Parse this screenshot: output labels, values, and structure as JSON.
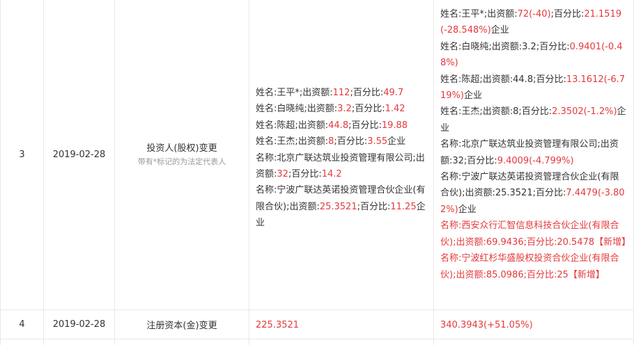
{
  "rows": [
    {
      "index": "3",
      "date": "2019-02-28",
      "item": "投资人(股权)变更",
      "note": "带有*标记的为法定代表人",
      "before": [
        [
          {
            "t": "姓名:王平*;出资额:"
          },
          {
            "t": "112",
            "r": true
          },
          {
            "t": ";百分比:"
          },
          {
            "t": "49.7",
            "r": true
          }
        ],
        [
          {
            "t": "姓名:白晓纯;出资额:"
          },
          {
            "t": "3.2",
            "r": true
          },
          {
            "t": ";百分比:"
          },
          {
            "t": "1.42",
            "r": true
          }
        ],
        [
          {
            "t": "姓名:陈超;出资额:"
          },
          {
            "t": "44.8",
            "r": true
          },
          {
            "t": ";百分比:"
          },
          {
            "t": "19.88",
            "r": true
          }
        ],
        [
          {
            "t": "姓名:王杰;出资额:"
          },
          {
            "t": "8",
            "r": true
          },
          {
            "t": ";百分比:"
          },
          {
            "t": "3.55",
            "r": true
          },
          {
            "t": "企业"
          }
        ],
        [
          {
            "t": "名称:北京广联达筑业投资管理有限公司;出资额:"
          },
          {
            "t": "32",
            "r": true
          },
          {
            "t": ";百分比:"
          },
          {
            "t": "14.2",
            "r": true
          }
        ],
        [
          {
            "t": "名称:宁波广联达英诺投资管理合伙企业(有限合伙);出资额:"
          },
          {
            "t": "25.3521",
            "r": true
          },
          {
            "t": ";百分比:"
          },
          {
            "t": "11.25",
            "r": true
          },
          {
            "t": "企业"
          }
        ]
      ],
      "after": [
        [
          {
            "t": "姓名:王平*;出资额:"
          },
          {
            "t": "72(-40)",
            "r": true
          },
          {
            "t": ";百分比:"
          },
          {
            "t": "21.1519(-28.548%)",
            "r": true
          },
          {
            "t": "企业"
          }
        ],
        [
          {
            "t": "姓名:白晓纯;出资额:3.2;百分比:"
          },
          {
            "t": "0.9401(-0.48%)",
            "r": true
          }
        ],
        [
          {
            "t": "姓名:陈超;出资额:44.8;百分比:"
          },
          {
            "t": "13.1612(-6.719%)",
            "r": true
          },
          {
            "t": "企业"
          }
        ],
        [
          {
            "t": "姓名:王杰;出资额:8;百分比:"
          },
          {
            "t": "2.3502(-1.2%)",
            "r": true
          },
          {
            "t": "企业"
          }
        ],
        [
          {
            "t": "名称:北京广联达筑业投资管理有限公司;出资额:32;百分比:"
          },
          {
            "t": "9.4009(-4.799%)",
            "r": true
          }
        ],
        [
          {
            "t": "名称:宁波广联达英诺投资管理合伙企业(有限合伙);出资额:25.3521;百分比:"
          },
          {
            "t": "7.4479(-3.802%)",
            "r": true
          },
          {
            "t": "企业"
          }
        ],
        [
          {
            "t": "名称:西安众行汇智信息科技合伙企业(有限合伙);出资额:69.9436;百分比:20.5478【新增】",
            "r": true
          }
        ],
        [
          {
            "t": "名称:宁波红杉华盛股权投资合伙企业(有限合伙);出资额:85.0986;百分比:25【新增】",
            "r": true
          }
        ]
      ]
    },
    {
      "index": "4",
      "date": "2019-02-28",
      "item": "注册资本(金)变更",
      "before_value": "225.3521",
      "after_value": "340.3943(+51.05%)"
    }
  ],
  "colors": {
    "accent_red": "#e4393c",
    "text": "#333333",
    "muted": "#999999",
    "border": "#e8e8e8"
  }
}
